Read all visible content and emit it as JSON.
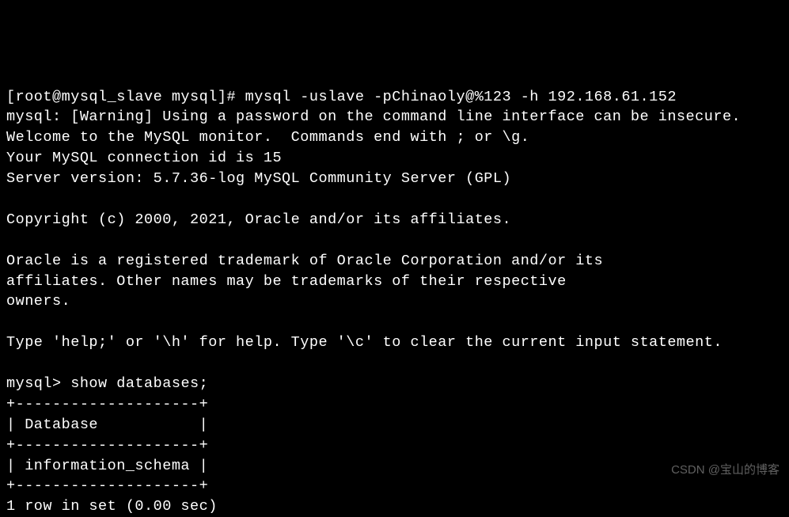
{
  "terminal": {
    "prompt": "[root@mysql_slave mysql]# ",
    "command": "mysql -uslave -pChinaoly@%123 -h 192.168.61.152",
    "warning": "mysql: [Warning] Using a password on the command line interface can be insecure.",
    "welcome": "Welcome to the MySQL monitor.  Commands end with ; or \\g.",
    "connection_id": "Your MySQL connection id is 15",
    "server_version": "Server version: 5.7.36-log MySQL Community Server (GPL)",
    "copyright": "Copyright (c) 2000, 2021, Oracle and/or its affiliates.",
    "trademark_line1": "Oracle is a registered trademark of Oracle Corporation and/or its",
    "trademark_line2": "affiliates. Other names may be trademarks of their respective",
    "trademark_line3": "owners.",
    "help_line": "Type 'help;' or '\\h' for help. Type '\\c' to clear the current input statement.",
    "mysql_prompt": "mysql> ",
    "sql_command": "show databases;",
    "table_border": "+--------------------+",
    "table_header": "| Database           |",
    "table_row1": "| information_schema |",
    "result_summary": "1 row in set (0.00 sec)"
  },
  "watermark": "CSDN @宝山的博客"
}
